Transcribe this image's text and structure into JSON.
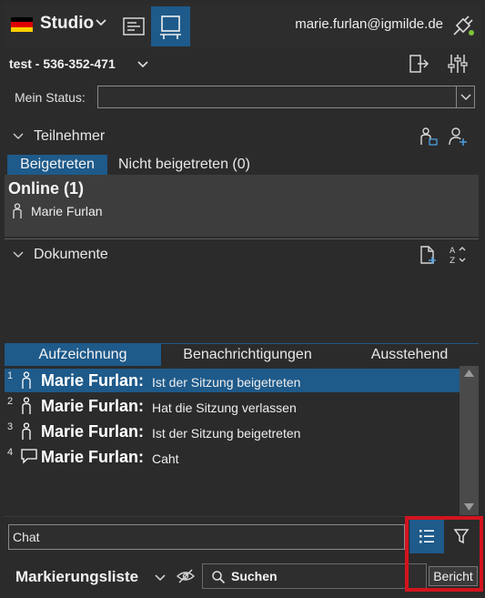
{
  "topbar": {
    "studio_label": "Studio",
    "user_email": "marie.furlan@igmilde.de",
    "flag_colors": [
      "#000000",
      "#dd0000",
      "#ffce00"
    ],
    "accent_color": "#1e5a8a"
  },
  "session": {
    "title": "test - 536-352-471"
  },
  "status": {
    "label": "Mein Status:",
    "value": ""
  },
  "participants": {
    "title": "Teilnehmer",
    "tabs": [
      {
        "label": "Beigetreten",
        "active": true
      },
      {
        "label": "Nicht beigetreten (0)",
        "active": false
      }
    ],
    "online_label": "Online (1)",
    "people": [
      {
        "name": "Marie Furlan"
      }
    ]
  },
  "documents": {
    "title": "Dokumente"
  },
  "log": {
    "tabs": [
      {
        "label": "Aufzeichnung",
        "active": true
      },
      {
        "label": "Benachrichtigungen",
        "active": false
      },
      {
        "label": "Ausstehend",
        "active": false
      }
    ],
    "entries": [
      {
        "num": "1",
        "icon": "person-icon",
        "name": "Marie Furlan:",
        "message": "Ist der Sitzung beigetreten",
        "selected": true
      },
      {
        "num": "2",
        "icon": "person-icon",
        "name": "Marie Furlan:",
        "message": "Hat die Sitzung verlassen",
        "selected": false
      },
      {
        "num": "3",
        "icon": "person-icon",
        "name": "Marie Furlan:",
        "message": "Ist der Sitzung beigetreten",
        "selected": false
      },
      {
        "num": "4",
        "icon": "chat-bubble-icon",
        "name": "Marie Furlan:",
        "message": "Caht",
        "selected": false
      }
    ]
  },
  "chat": {
    "value": "Chat"
  },
  "markers": {
    "title": "Markierungsliste",
    "search_text": "Suchen",
    "report_label": "Bericht"
  }
}
